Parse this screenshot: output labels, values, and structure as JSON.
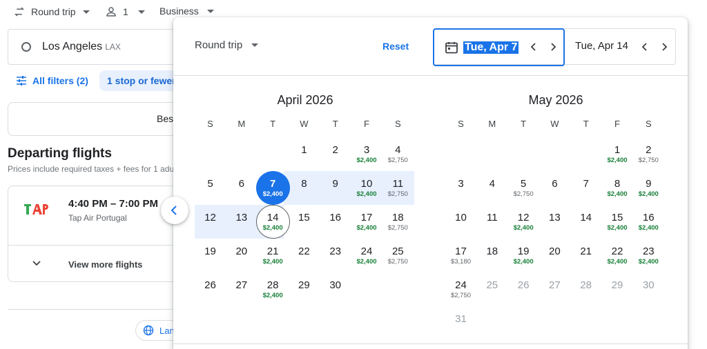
{
  "topbar": {
    "trip_type": "Round trip",
    "passengers": "1",
    "cabin": "Business"
  },
  "search": {
    "origin_city": "Los Angeles",
    "origin_code": "LAX"
  },
  "filters": {
    "all_filters": "All filters (2)",
    "stops_chip": "1 stop or fewer"
  },
  "sort": {
    "best_tab": "Bes"
  },
  "results": {
    "title": "Departing flights",
    "subtitle": "Prices include required taxes + fees for 1 adu",
    "flight": {
      "time": "4:40 PM – 7:00 PM",
      "airline": "Tap Air Portugal",
      "logo": "tap-logo"
    },
    "more_flights": "View more flights",
    "language_button": "Lan"
  },
  "picker": {
    "trip_select": "Round trip",
    "reset": "Reset",
    "departure": "Tue, Apr 7",
    "return": "Tue, Apr 14",
    "weekdays": [
      "S",
      "M",
      "T",
      "W",
      "T",
      "F",
      "S"
    ],
    "months": [
      {
        "title": "April 2026",
        "days": [
          {
            "d": "1",
            "p": ""
          },
          {
            "d": "2",
            "p": ""
          },
          {
            "d": "3",
            "p": "$2,400",
            "low": true
          },
          {
            "d": "4",
            "p": "$2,750"
          },
          {
            "d": "5",
            "p": ""
          },
          {
            "d": "6",
            "p": ""
          },
          {
            "d": "7",
            "p": "$2,400",
            "low": true,
            "state": "start"
          },
          {
            "d": "8",
            "p": ""
          },
          {
            "d": "9",
            "p": ""
          },
          {
            "d": "10",
            "p": "$2,400",
            "low": true
          },
          {
            "d": "11",
            "p": "$2,750"
          },
          {
            "d": "12",
            "p": ""
          },
          {
            "d": "13",
            "p": ""
          },
          {
            "d": "14",
            "p": "$2,400",
            "low": true,
            "state": "end"
          },
          {
            "d": "15",
            "p": ""
          },
          {
            "d": "16",
            "p": ""
          },
          {
            "d": "17",
            "p": "$2,400",
            "low": true
          },
          {
            "d": "18",
            "p": "$2,750"
          },
          {
            "d": "19",
            "p": ""
          },
          {
            "d": "20",
            "p": ""
          },
          {
            "d": "21",
            "p": "$2,400",
            "low": true
          },
          {
            "d": "22",
            "p": ""
          },
          {
            "d": "23",
            "p": ""
          },
          {
            "d": "24",
            "p": "$2,400",
            "low": true
          },
          {
            "d": "25",
            "p": "$2,750"
          },
          {
            "d": "26",
            "p": ""
          },
          {
            "d": "27",
            "p": ""
          },
          {
            "d": "28",
            "p": "$2,400",
            "low": true
          },
          {
            "d": "29",
            "p": ""
          },
          {
            "d": "30",
            "p": ""
          }
        ]
      },
      {
        "title": "May 2026",
        "days": [
          {
            "d": "1",
            "p": "$2,400",
            "low": true
          },
          {
            "d": "2",
            "p": "$2,750"
          },
          {
            "d": "3",
            "p": ""
          },
          {
            "d": "4",
            "p": ""
          },
          {
            "d": "5",
            "p": "$2,750"
          },
          {
            "d": "6",
            "p": ""
          },
          {
            "d": "7",
            "p": ""
          },
          {
            "d": "8",
            "p": "$2,400",
            "low": true
          },
          {
            "d": "9",
            "p": "$2,400",
            "low": true
          },
          {
            "d": "10",
            "p": ""
          },
          {
            "d": "11",
            "p": ""
          },
          {
            "d": "12",
            "p": "$2,400",
            "low": true
          },
          {
            "d": "13",
            "p": ""
          },
          {
            "d": "14",
            "p": ""
          },
          {
            "d": "15",
            "p": "$2,400",
            "low": true
          },
          {
            "d": "16",
            "p": "$2,400",
            "low": true
          },
          {
            "d": "17",
            "p": "$3,180"
          },
          {
            "d": "18",
            "p": ""
          },
          {
            "d": "19",
            "p": "$2,400",
            "low": true
          },
          {
            "d": "20",
            "p": ""
          },
          {
            "d": "21",
            "p": ""
          },
          {
            "d": "22",
            "p": "$2,400",
            "low": true
          },
          {
            "d": "23",
            "p": "$2,400",
            "low": true
          },
          {
            "d": "24",
            "p": "$2,750"
          },
          {
            "d": "25",
            "p": "",
            "disabled": true
          },
          {
            "d": "26",
            "p": "",
            "disabled": true
          },
          {
            "d": "27",
            "p": "",
            "disabled": true
          },
          {
            "d": "28",
            "p": "",
            "disabled": true
          },
          {
            "d": "29",
            "p": "",
            "disabled": true
          },
          {
            "d": "30",
            "p": "",
            "disabled": true
          },
          {
            "d": "31",
            "p": "",
            "disabled": true
          }
        ]
      }
    ]
  },
  "colors": {
    "accent": "#1a73e8",
    "range": "#e8f0fe",
    "low_price": "#188038",
    "tap_green": "#34a853",
    "tap_red": "#ea4335"
  }
}
